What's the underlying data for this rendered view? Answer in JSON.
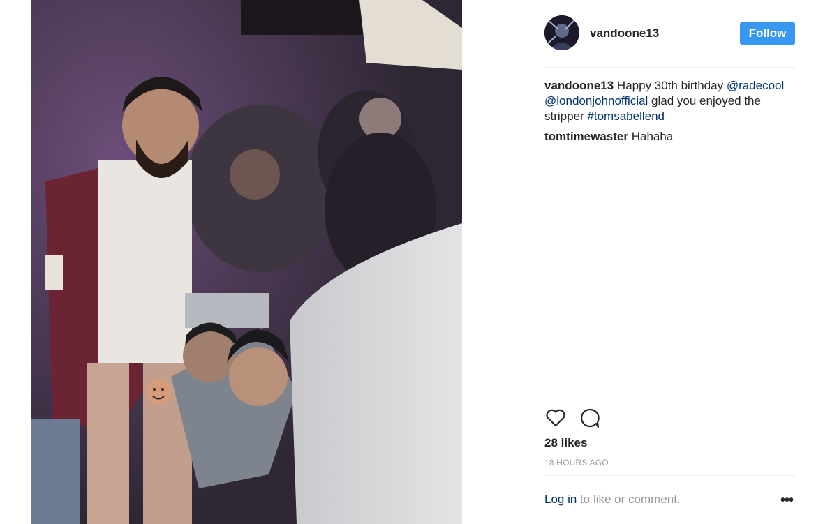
{
  "post": {
    "username": "vandoone13",
    "follow_label": "Follow",
    "caption": {
      "user": "vandoone13",
      "text1": " Happy 30th birthday ",
      "mention1": "@radecool",
      "space": " ",
      "mention2": "@londonjohnofficial",
      "text2": " glad you enjoyed the stripper ",
      "hashtag": "#tomsabellend"
    },
    "comment": {
      "user": "tomtimewaster",
      "text": " Hahaha"
    },
    "likes": "28 likes",
    "time": "18 HOURS AGO",
    "login_link": "Log in",
    "login_rest": " to like or comment.",
    "more": "•••"
  },
  "icons": [
    "heart-icon",
    "comment-icon",
    "more-options-icon"
  ],
  "colors": {
    "follow": "#3897f0",
    "link": "#003569",
    "muted": "#999999"
  }
}
